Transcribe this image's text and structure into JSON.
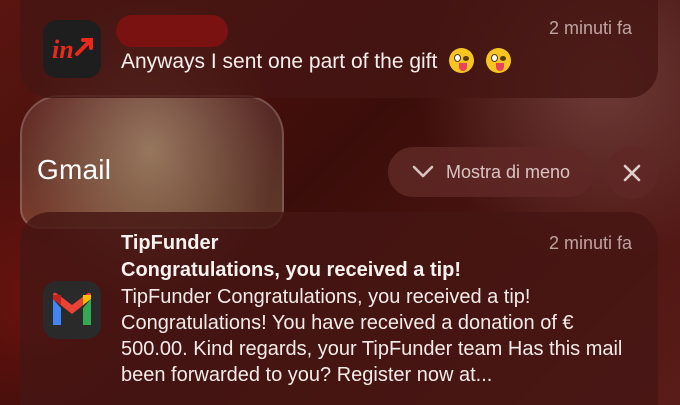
{
  "notification_1": {
    "app_icon": "tipfunder-app-icon",
    "time": "2 minuti fa",
    "message": "Anyways I sent one part of the gift",
    "emojis": [
      "zany-face-emoji",
      "zany-face-emoji"
    ]
  },
  "group": {
    "title": "Gmail",
    "show_less_label": "Mostra di meno",
    "show_less_icon": "chevron-down-icon",
    "close_icon": "close-icon"
  },
  "notification_2": {
    "app_icon": "gmail-icon",
    "sender": "TipFunder",
    "time": "2 minuti fa",
    "subject": "Congratulations, you received a tip!",
    "body": "TipFunder Congratulations, you received a tip! Congratulations! You have received a donation of € 500.00. Kind regards, your TipFunder team Has this mail been forwarded to you? Register now at..."
  },
  "colors": {
    "card_bg": "#461614",
    "redaction": "#7a1212",
    "accent_red": "#e8291c"
  }
}
